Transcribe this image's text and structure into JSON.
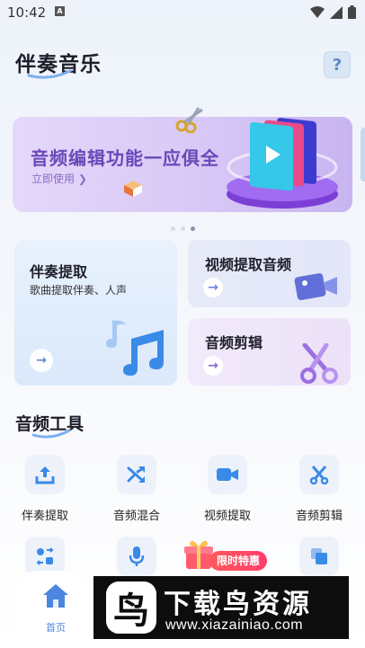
{
  "status_bar": {
    "time": "10:42",
    "badge": "A"
  },
  "header": {
    "title": "伴奏音乐",
    "help": "?"
  },
  "banner": {
    "title": "音频编辑功能一应俱全",
    "link": "立即使用 ❯",
    "active_slide_index": 2,
    "slide_count": 3
  },
  "feature_cards": {
    "accompaniment": {
      "title": "伴奏提取",
      "subtitle": "歌曲提取伴奏、人声",
      "arrow": "→"
    },
    "video_audio": {
      "title": "视频提取音频",
      "arrow": "→"
    },
    "audio_cut": {
      "title": "音频剪辑",
      "arrow": "→"
    }
  },
  "tools_section": {
    "title": "音频工具",
    "tools": [
      {
        "label": "伴奏提取",
        "icon": "upload-icon"
      },
      {
        "label": "音频混合",
        "icon": "shuffle-icon"
      },
      {
        "label": "视频提取",
        "icon": "video-camera-icon"
      },
      {
        "label": "音频剪辑",
        "icon": "scissors-icon"
      }
    ],
    "partial_tools": [
      {
        "icon": "format-convert-icon"
      },
      {
        "icon": "microphone-icon"
      },
      {
        "icon": "copy-icon"
      }
    ]
  },
  "promo": {
    "label": "限时特惠"
  },
  "bottom_nav": {
    "home": "首页"
  },
  "watermark": {
    "text": "下载鸟资源",
    "url": "www.xiazainiao.com",
    "logo": "鸟"
  },
  "colors": {
    "accent_blue": "#4d86e0",
    "banner_purple": "#6a48b8",
    "promo_red": "#ff4d63"
  }
}
